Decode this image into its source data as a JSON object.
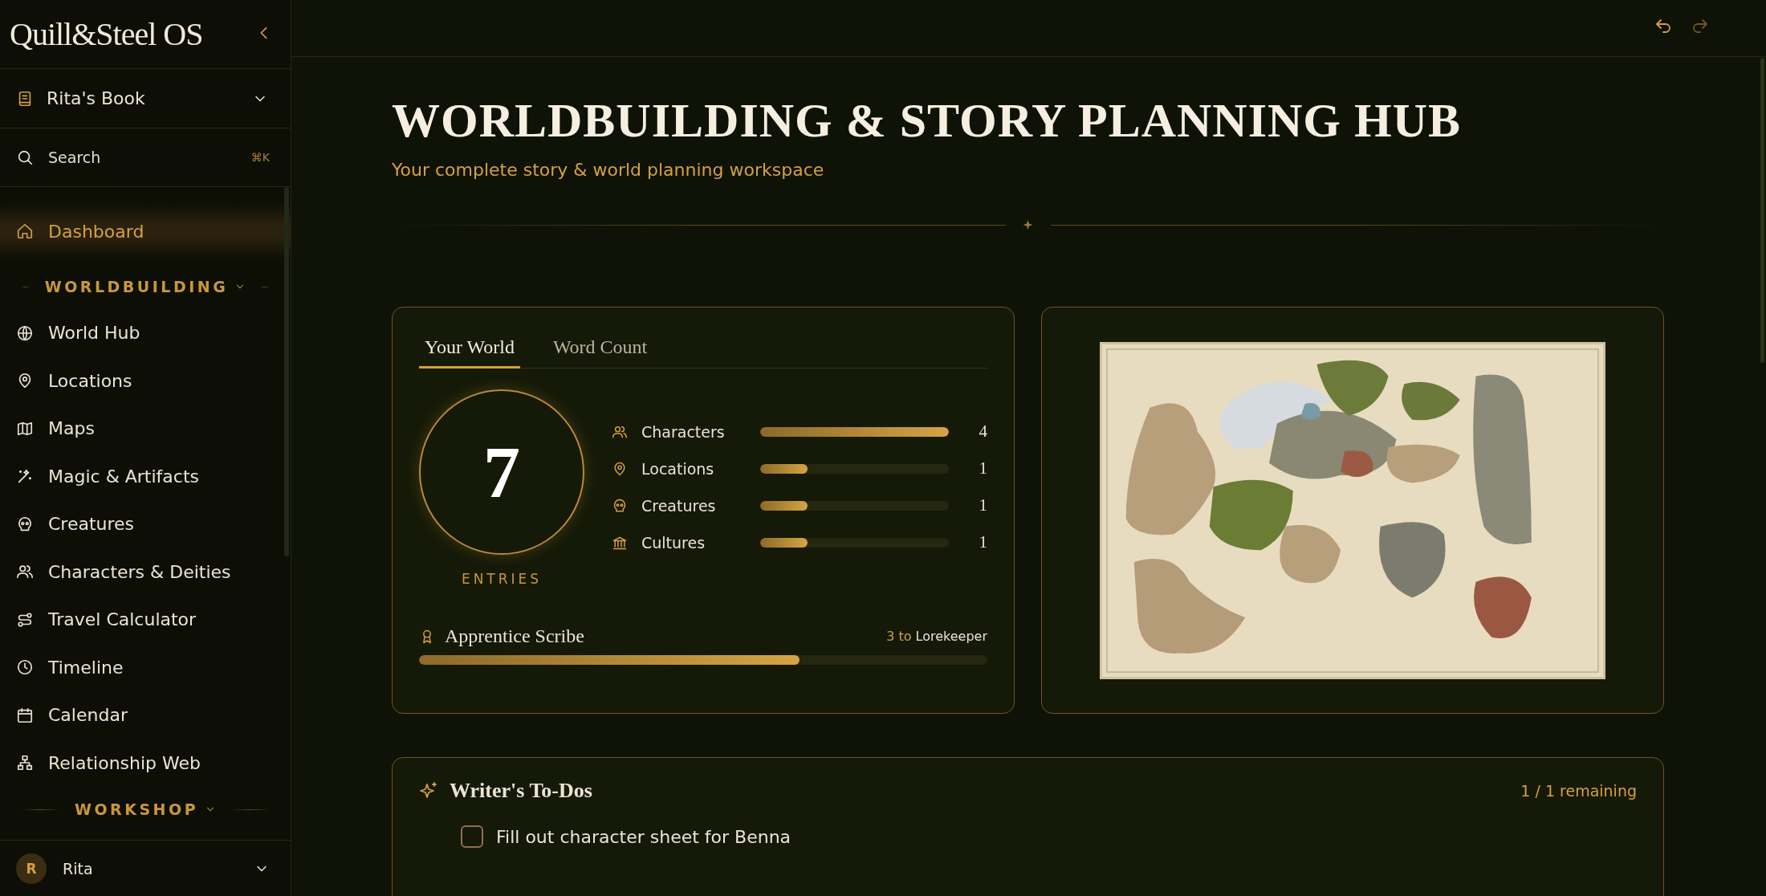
{
  "sidebar": {
    "logo": "Quill&Steel OS",
    "book": "Rita's Book",
    "search": {
      "placeholder": "Search",
      "shortcut": "⌘K"
    },
    "dashboard": {
      "label": "Dashboard",
      "selected": true
    },
    "sections": [
      {
        "title": "WORLDBUILDING",
        "items": [
          {
            "label": "World Hub",
            "selected": false
          },
          {
            "label": "Locations",
            "selected": false
          },
          {
            "label": "Maps",
            "selected": false
          },
          {
            "label": "Magic & Artifacts",
            "selected": false
          },
          {
            "label": "Creatures",
            "selected": false
          },
          {
            "label": "Characters & Deities",
            "selected": false
          },
          {
            "label": "Travel Calculator",
            "selected": false
          },
          {
            "label": "Timeline",
            "selected": false
          },
          {
            "label": "Calendar",
            "selected": false
          },
          {
            "label": "Relationship Web",
            "selected": false
          }
        ]
      },
      {
        "title": "WORKSHOP"
      }
    ],
    "user": {
      "initial": "R",
      "name": "Rita"
    }
  },
  "toolbar": {
    "undo_disabled": false,
    "redo_disabled": true
  },
  "header": {
    "title": "WORLDBUILDING & STORY PLANNING HUB",
    "subtitle": "Your complete story & world planning workspace"
  },
  "stats": {
    "tabs": [
      {
        "label": "Your World",
        "selected": true
      },
      {
        "label": "Word Count",
        "selected": false
      }
    ],
    "total": "7",
    "total_label": "ENTRIES",
    "categories": [
      {
        "name": "Characters",
        "level": 1,
        "count": "4"
      },
      {
        "name": "Locations",
        "level": 0.25,
        "count": "1"
      },
      {
        "name": "Creatures",
        "level": 0.25,
        "count": "1"
      },
      {
        "name": "Cultures",
        "level": 0.25,
        "count": "1"
      }
    ],
    "rank": {
      "title": "Apprentice Scribe",
      "remaining": "3 to",
      "next": "Lorekeeper",
      "level": 0.67
    }
  },
  "todos": {
    "title": "Writer's To-Dos",
    "remaining": "1 / 1 remaining",
    "items": [
      {
        "text": "Fill out character sheet for Benna",
        "checked": false
      }
    ]
  }
}
